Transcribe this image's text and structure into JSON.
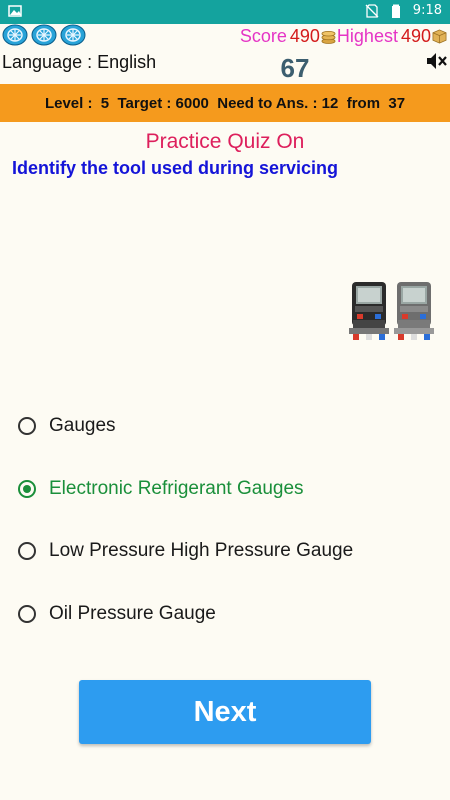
{
  "status_bar": {
    "time": "9:18",
    "icons": [
      "picture-icon",
      "no-sim-icon",
      "battery-icon"
    ]
  },
  "header": {
    "score_label": "Score",
    "score_value": "490",
    "highest_label": "Highest",
    "highest_value": "490",
    "language_text": "Language : English",
    "counter": "67",
    "icons": [
      "snowflake-bubble-icon",
      "coins-icon",
      "box-icon",
      "mute-icon"
    ]
  },
  "level_bar": {
    "text": "Level :  5  Target : 6000  Need to Ans. : 12  from  37"
  },
  "quiz": {
    "title": "Practice Quiz On",
    "question": "Identify the tool used during servicing",
    "image": "refrigerant-gauges-image",
    "options": [
      {
        "label": "Gauges",
        "selected": false
      },
      {
        "label": "Electronic Refrigerant Gauges",
        "selected": true
      },
      {
        "label": "Low Pressure High Pressure Gauge",
        "selected": false
      },
      {
        "label": "Oil Pressure Gauge",
        "selected": false
      }
    ]
  },
  "next_button": {
    "label": "Next"
  },
  "colors": {
    "status_bar": "#14a39e",
    "level_bar": "#f59a1d",
    "next_button": "#2d9cf0",
    "selected": "#1a8f3a",
    "question": "#1414d8",
    "title": "#dd1f5c"
  }
}
